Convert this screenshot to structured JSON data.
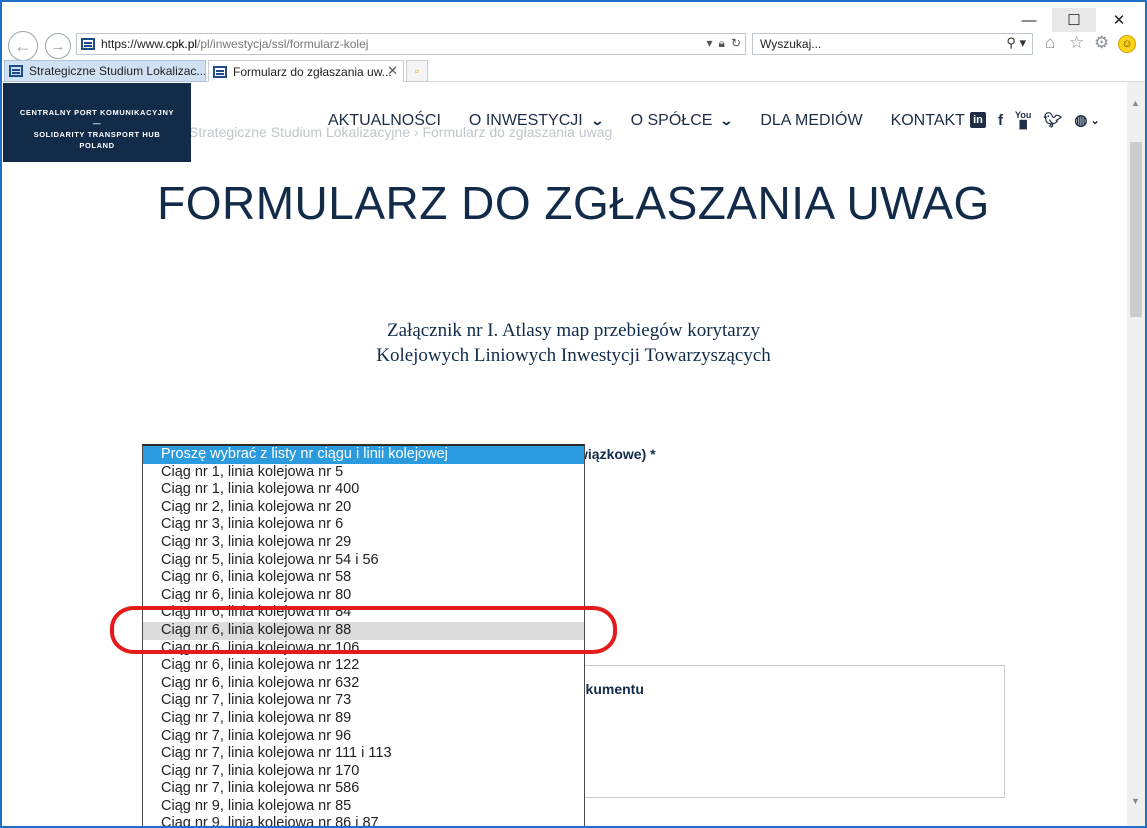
{
  "window": {
    "minimize": "—",
    "maximize": "☐",
    "close": "✕"
  },
  "address_bar": {
    "url_prefix": "https://www.",
    "url_domain": "cpk.pl",
    "url_path": "/pl/inwestycja/ssl/formularz-kolej"
  },
  "search_bar": {
    "placeholder": "Wyszukaj..."
  },
  "tabs": [
    {
      "label": "Strategiczne Studium Lokalizac..."
    },
    {
      "label": "Formularz do zgłaszania uw..."
    }
  ],
  "logo": {
    "line1": "CENTRALNY PORT KOMUNIKACYJNY",
    "separator": "—",
    "line2": "SOLIDARITY TRANSPORT HUB",
    "line3": "POLAND"
  },
  "breadcrumb": "Strategiczne Studium Lokalizacyjne  ›  Formularz do zgłaszania uwag",
  "nav": {
    "items": [
      "AKTUALNOŚCI",
      "O INWESTYCJI",
      "O SPÓŁCE",
      "DLA MEDIÓW",
      "KONTAKT"
    ]
  },
  "social_icons": [
    "linkedin-icon",
    "facebook-icon",
    "youtube-icon",
    "twitter-icon",
    "globe-icon"
  ],
  "page": {
    "title": "FORMULARZ DO ZGŁASZANIA UWAG",
    "subtitle_line1": "Załącznik nr I. Atlasy map przebiegów korytarzy",
    "subtitle_line2": "Kolejowych Liniowych Inwestycji Towarzyszących",
    "field_label_tail": "wiązkowe)",
    "required_mark": "*",
    "doc_label_tail": "okumentu"
  },
  "dropdown": {
    "placeholder": "Proszę wybrać z listy nr ciągu i linii kolejowej",
    "hovered_option": "Ciąg nr 6, linia kolejowa nr 88",
    "options": [
      "Ciąg nr 1, linia kolejowa nr 5",
      "Ciąg nr 1, linia kolejowa nr 400",
      "Ciąg nr 2, linia kolejowa nr 20",
      "Ciąg nr 3, linia kolejowa nr 6",
      "Ciąg nr 3, linia kolejowa nr 29",
      "Ciąg nr 5, linia kolejowa nr 54 i 56",
      "Ciąg nr 6, linia kolejowa nr 58",
      "Ciąg nr 6, linia kolejowa nr 80",
      "Ciąg nr 6, linia kolejowa nr 84",
      "Ciąg nr 6, linia kolejowa nr 88",
      "Ciąg nr 6, linia kolejowa nr 106",
      "Ciąg nr 6, linia kolejowa nr 122",
      "Ciąg nr 6, linia kolejowa nr 632",
      "Ciąg nr 7, linia kolejowa nr 73",
      "Ciąg nr 7, linia kolejowa nr 89",
      "Ciąg nr 7, linia kolejowa nr 96",
      "Ciąg nr 7, linia kolejowa nr 111 i 113",
      "Ciąg nr 7, linia kolejowa nr 170",
      "Ciąg nr 7, linia kolejowa nr 586",
      "Ciąg nr 9, linia kolejowa nr 85",
      "Ciąg nr 9, linia kolejowa nr 86 i 87"
    ]
  },
  "colors": {
    "brand_navy": "#112b48",
    "selection_blue": "#2b9be0",
    "annotation_red": "#e41b1b",
    "frame_blue": "#1e6fc8"
  }
}
